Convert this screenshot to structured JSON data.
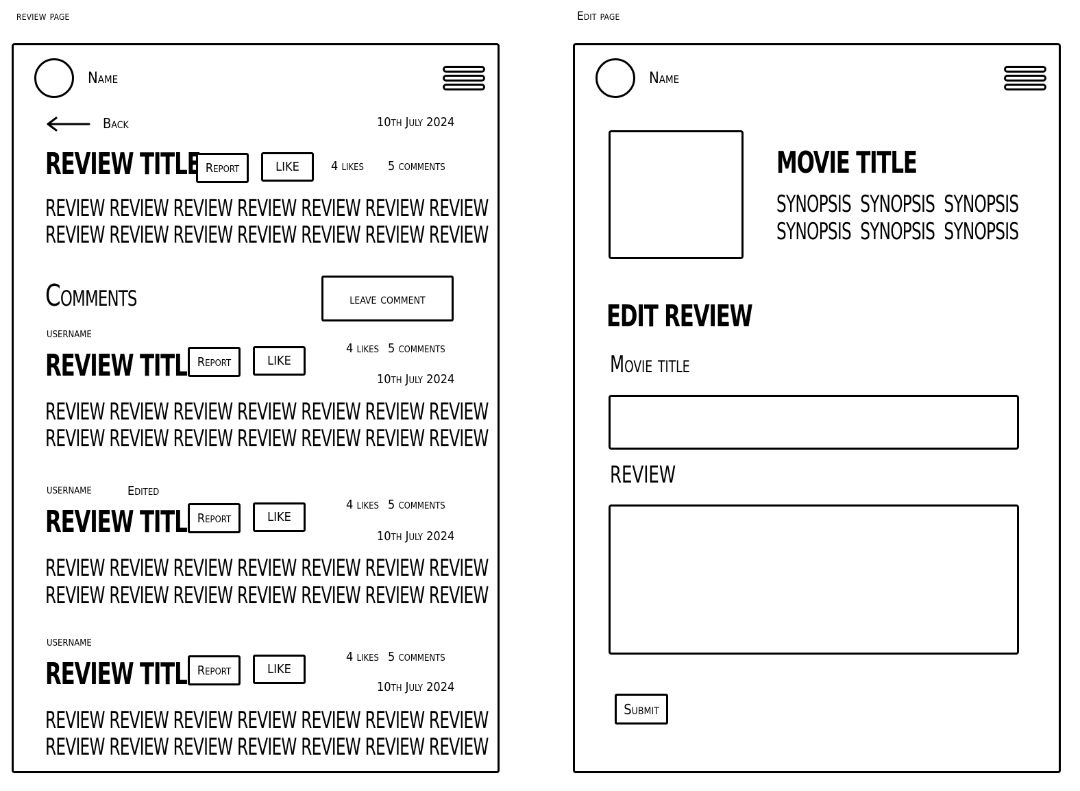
{
  "review_page": {
    "caption": "review page",
    "header": {
      "name": "Name"
    },
    "back_label": "Back",
    "date": "10th July 2024",
    "review": {
      "title": "REVIEW TITLE",
      "report_label": "Report",
      "like_label": "LIKE",
      "likes": "4 likes",
      "comments": "5 comments",
      "line1": "REVIEW REVIEW REVIEW REVIEW REVIEW REVIEW REVIEW",
      "line2": "REVIEW REVIEW REVIEW REVIEW REVIEW REVIEW REVIEW"
    },
    "comments_heading": "Comments",
    "leave_comment_label": "leave comment",
    "comments": [
      {
        "username": "username",
        "edited": "",
        "title": "REVIEW TITLE",
        "report_label": "Report",
        "like_label": "LIKE",
        "likes": "4 likes",
        "comments": "5 comments",
        "date": "10th July 2024",
        "line1": "REVIEW REVIEW REVIEW REVIEW REVIEW REVIEW REVIEW",
        "line2": "REVIEW REVIEW REVIEW REVIEW REVIEW REVIEW REVIEW"
      },
      {
        "username": "username",
        "edited": "Edited",
        "title": "REVIEW TITLE",
        "report_label": "Report",
        "like_label": "LIKE",
        "likes": "4 likes",
        "comments": "5 comments",
        "date": "10th July 2024",
        "line1": "REVIEW REVIEW REVIEW REVIEW REVIEW REVIEW REVIEW",
        "line2": "REVIEW REVIEW REVIEW REVIEW REVIEW REVIEW REVIEW"
      },
      {
        "username": "username",
        "edited": "",
        "title": "REVIEW TITLE",
        "report_label": "Report",
        "like_label": "LIKE",
        "likes": "4 likes",
        "comments": "5 comments",
        "date": "10th July 2024",
        "line1": "REVIEW REVIEW REVIEW REVIEW REVIEW REVIEW REVIEW",
        "line2": "REVIEW REVIEW REVIEW REVIEW REVIEW REVIEW REVIEW"
      }
    ]
  },
  "edit_page": {
    "caption": "Edit page",
    "header": {
      "name": "Name"
    },
    "movie": {
      "title": "MOVIE TITLE",
      "synopsis_line1": "SYNOPSIS  SYNOPSIS  SYNOPSIS",
      "synopsis_line2": "SYNOPSIS  SYNOPSIS  SYNOPSIS"
    },
    "heading": "EDIT REVIEW",
    "movie_title_label": "Movie title",
    "review_label": "REVIEW",
    "submit_label": "Submit"
  },
  "icons": [
    "avatar-circle",
    "hamburger-menu-icon",
    "back-arrow-icon",
    "movie-poster-placeholder"
  ]
}
